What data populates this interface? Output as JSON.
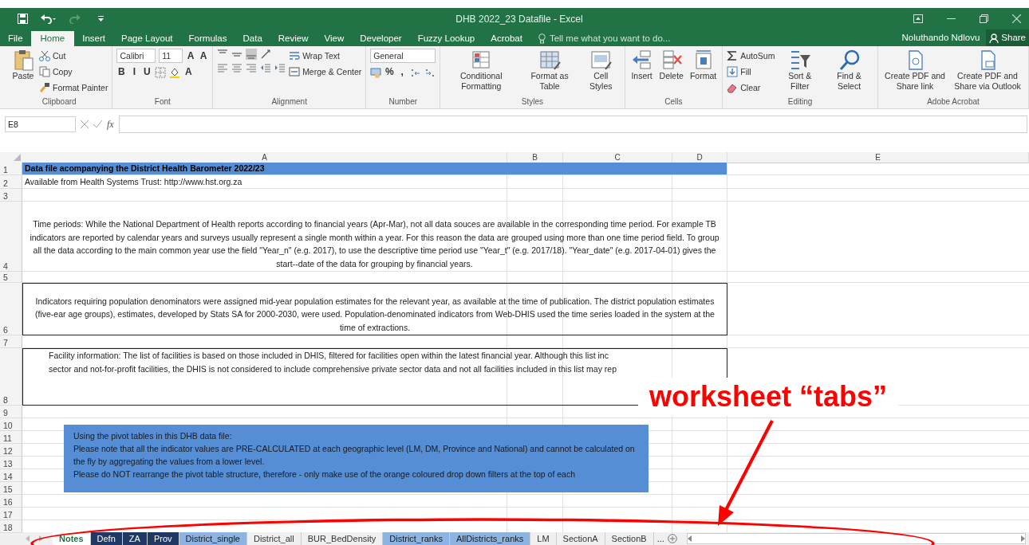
{
  "window": {
    "title": "DHB 2022_23 Datafile - Excel",
    "user": "Noluthando Ndlovu",
    "share": "Share",
    "tell_me": "Tell me what you want to do..."
  },
  "menu_tabs": [
    {
      "label": "File",
      "selected": false
    },
    {
      "label": "Home",
      "selected": true
    },
    {
      "label": "Insert",
      "selected": false
    },
    {
      "label": "Page Layout",
      "selected": false
    },
    {
      "label": "Formulas",
      "selected": false
    },
    {
      "label": "Data",
      "selected": false
    },
    {
      "label": "Review",
      "selected": false
    },
    {
      "label": "View",
      "selected": false
    },
    {
      "label": "Developer",
      "selected": false
    },
    {
      "label": "Fuzzy Lookup",
      "selected": false
    },
    {
      "label": "Acrobat",
      "selected": false
    }
  ],
  "ribbon": [
    {
      "label": "Clipboard",
      "parts": [
        {
          "kind": "large",
          "label": "Paste"
        },
        {
          "kind": "stack",
          "items": [
            {
              "kind": "small",
              "label": "Cut"
            },
            {
              "kind": "small",
              "label": "Copy"
            },
            {
              "kind": "small",
              "label": "Format Painter"
            }
          ]
        }
      ]
    },
    {
      "label": "Font",
      "parts": [
        {
          "kind": "stack",
          "items": [
            {
              "kind": "line",
              "items": [
                {
                  "kind": "combo",
                  "label": "Calibri"
                },
                {
                  "kind": "combo",
                  "label": "11"
                },
                {
                  "kind": "glyph",
                  "label": "A"
                },
                {
                  "kind": "glyph",
                  "label": "A"
                }
              ]
            },
            {
              "kind": "line",
              "items": [
                {
                  "kind": "glyph",
                  "label": "B"
                },
                {
                  "kind": "glyph",
                  "label": "I"
                },
                {
                  "kind": "glyph",
                  "label": "U"
                },
                {
                  "kind": "icon"
                },
                {
                  "kind": "icon"
                },
                {
                  "kind": "glyph",
                  "label": "A"
                }
              ]
            }
          ]
        }
      ]
    },
    {
      "label": "Alignment",
      "parts": [
        {
          "kind": "stack",
          "items": [
            {
              "kind": "line",
              "items": [
                {
                  "kind": "icon"
                },
                {
                  "kind": "icon"
                },
                {
                  "kind": "icon"
                },
                {
                  "kind": "icon"
                }
              ]
            },
            {
              "kind": "line",
              "items": [
                {
                  "kind": "icon"
                },
                {
                  "kind": "icon"
                },
                {
                  "kind": "icon"
                },
                {
                  "kind": "icon"
                },
                {
                  "kind": "icon"
                }
              ]
            }
          ]
        },
        {
          "kind": "stack",
          "items": [
            {
              "kind": "small",
              "label": "Wrap Text"
            },
            {
              "kind": "small",
              "label": "Merge & Center"
            }
          ]
        }
      ]
    },
    {
      "label": "Number",
      "parts": [
        {
          "kind": "stack",
          "items": [
            {
              "kind": "combo",
              "label": "General"
            },
            {
              "kind": "line",
              "items": [
                {
                  "kind": "icon"
                },
                {
                  "kind": "glyph",
                  "label": "%"
                },
                {
                  "kind": "glyph",
                  "label": ","
                },
                {
                  "kind": "icon"
                },
                {
                  "kind": "icon"
                }
              ]
            }
          ]
        }
      ]
    },
    {
      "label": "Styles",
      "parts": [
        {
          "kind": "large",
          "label": "Conditional Formatting"
        },
        {
          "kind": "large",
          "label": "Format as Table"
        },
        {
          "kind": "large",
          "label": "Cell Styles"
        }
      ]
    },
    {
      "label": "Cells",
      "parts": [
        {
          "kind": "large",
          "label": "Insert"
        },
        {
          "kind": "large",
          "label": "Delete"
        },
        {
          "kind": "large",
          "label": "Format"
        }
      ]
    },
    {
      "label": "Editing",
      "parts": [
        {
          "kind": "stack",
          "items": [
            {
              "kind": "small",
              "label": "AutoSum"
            },
            {
              "kind": "small",
              "label": "Fill"
            },
            {
              "kind": "small",
              "label": "Clear"
            }
          ]
        },
        {
          "kind": "large",
          "label": "Sort & Filter"
        },
        {
          "kind": "large",
          "label": "Find & Select"
        }
      ]
    },
    {
      "label": "Adobe Acrobat",
      "parts": [
        {
          "kind": "large",
          "label": "Create PDF and Share link"
        },
        {
          "kind": "large",
          "label": "Create PDF and Share via Outlook"
        }
      ]
    }
  ],
  "formula_bar": {
    "name_box": "E8",
    "fx": "fx"
  },
  "columns": [
    "A",
    "B",
    "C",
    "D",
    "E"
  ],
  "rows": [
    {
      "num": "1",
      "kind": "title",
      "text": "Data file acompanying the District Health Barometer 2022/23"
    },
    {
      "num": "2",
      "kind": "plain",
      "text": "Available from Health Systems Trust: http://www.hst.org.za"
    },
    {
      "num": "3",
      "kind": "empty"
    },
    {
      "num": "4",
      "kind": "note",
      "boxed": false,
      "text": "Time periods: While the National Department of Health reports according to financial years (Apr-Mar), not all data souces are available in the corresponding time period. For example TB indicators are reported by calendar years and surveys usually represent a single month within a year. For this reason the data are grouped using more than one time period field. To group all the data according to the main common year use the field \"Year_n\" (e.g. 2017), to use the descriptive time period use \"Year_t\" (e.g. 2017/18). \"Year_date\" (e.g. 2017-04-01) gives the start--date of the data for grouping by financial years."
    },
    {
      "num": "5",
      "kind": "empty"
    },
    {
      "num": "6",
      "kind": "note",
      "boxed": true,
      "text": "Indicators requiring population denominators were assigned mid-year population estimates for the relevant year, as available at the time of publication. The district population estimates (five-ear age groups), estimates, developed by Stats SA for 2000-2030, were used. Population-denominated indicators from Web-DHIS used the time series loaded in the system at the time of extractions."
    },
    {
      "num": "7",
      "kind": "empty"
    },
    {
      "num": "8",
      "kind": "note",
      "boxed": true,
      "lines": [
        "Facility information: The list of facilities is based on those included in DHIS, filtered for facilities open within the latest financial year. Although this list inc",
        "sector and not-for-profit facilities, the DHIS is not considered to include comprehensive private sector data and not all facilities included in this list may rep"
      ]
    },
    {
      "num": "9",
      "kind": "empty"
    },
    {
      "num": "10",
      "kind": "empty"
    },
    {
      "num": "11",
      "kind": "empty"
    },
    {
      "num": "12",
      "kind": "empty"
    },
    {
      "num": "13",
      "kind": "empty"
    },
    {
      "num": "14",
      "kind": "empty"
    },
    {
      "num": "15",
      "kind": "empty"
    },
    {
      "num": "16",
      "kind": "empty"
    },
    {
      "num": "17",
      "kind": "empty"
    },
    {
      "num": "18",
      "kind": "empty"
    }
  ],
  "text_box": {
    "heading": "Using the pivot tables in this DHB data file:",
    "paragraphs": [
      "Please note that all the indicator values are PRE-CALCULATED at each geographic level (LM, DM, Province and National) and cannot be calculated on the fly by aggregating the values from a lower level.",
      "Please do NOT rearrange the pivot table structure, therefore  - only make use of the orange coloured drop down filters at the top of each"
    ]
  },
  "sheet_tabs": [
    {
      "label": "Notes",
      "selected": true
    },
    {
      "label": "Defn",
      "selected": false,
      "color": "#1f3864"
    },
    {
      "label": "ZA",
      "selected": false,
      "color": "#1f3864"
    },
    {
      "label": "Prov",
      "selected": false,
      "color": "#1f3864"
    },
    {
      "label": "District_single",
      "selected": false,
      "color": "#8db4e2"
    },
    {
      "label": "District_all",
      "selected": false
    },
    {
      "label": "BUR_BedDensity",
      "selected": false
    },
    {
      "label": "District_ranks",
      "selected": false,
      "color": "#8db4e2"
    },
    {
      "label": "AllDistricts_ranks",
      "selected": false,
      "color": "#8db4e2"
    },
    {
      "label": "LM",
      "selected": false
    },
    {
      "label": "SectionA",
      "selected": false
    },
    {
      "label": "SectionB",
      "selected": false
    }
  ],
  "more_tabs": "...",
  "annotation": {
    "label": "worksheet “tabs”"
  }
}
